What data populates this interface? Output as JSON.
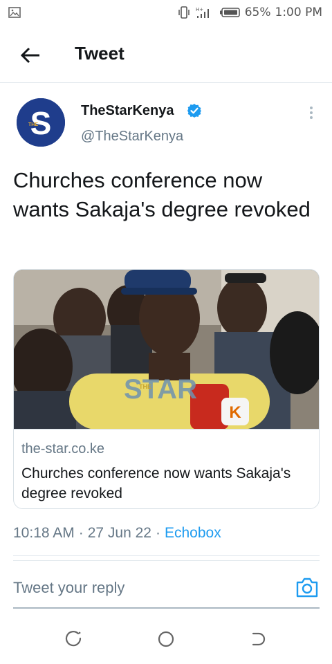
{
  "status_bar": {
    "battery_percent": "65%",
    "time": "1:00 PM",
    "network": "H+"
  },
  "header": {
    "title": "Tweet"
  },
  "tweet": {
    "author_name": "TheStarKenya",
    "author_handle": "@TheStarKenya",
    "avatar_letter": "S",
    "avatar_small_text": "THE",
    "text": "Churches conference now wants Sakaja's degree revoked",
    "card": {
      "domain": "the-star.co.ke",
      "title": "Churches conference now wants Sakaja's degree revoked",
      "image_watermark": "STAR",
      "image_watermark_small": "THE",
      "mic_label": "K"
    },
    "time": "10:18 AM",
    "date": "27 Jun 22",
    "separator": "·",
    "source": "Echobox"
  },
  "reply": {
    "placeholder": "Tweet your reply"
  },
  "colors": {
    "accent": "#1d9bf0",
    "avatar_bg": "#1f3d8c",
    "secondary_text": "#657786"
  },
  "icons": {
    "status_left": "image-icon",
    "back": "arrow-left-icon",
    "verified": "verified-badge-icon",
    "more": "more-vertical-icon",
    "camera": "camera-icon",
    "nav_recent": "recent-apps-icon",
    "nav_home": "home-circle-icon",
    "nav_back": "nav-back-icon"
  }
}
